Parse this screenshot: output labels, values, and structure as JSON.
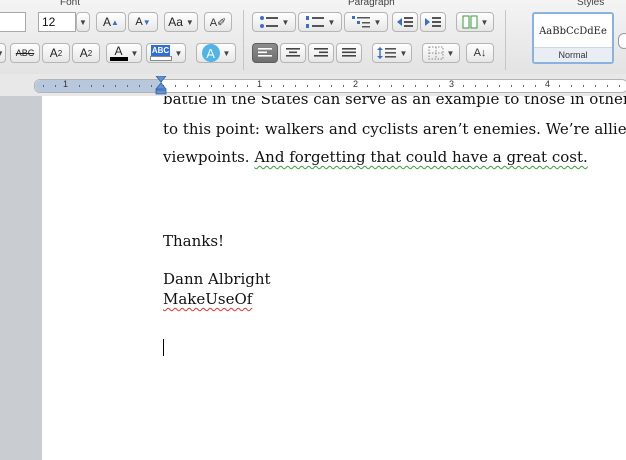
{
  "ribbon": {
    "groups": {
      "font": "Font",
      "paragraph": "Paragraph",
      "styles": "Styles"
    },
    "font_size": "12",
    "strikethrough_label": "ABC",
    "superscript_label": "A",
    "superscript_mark": "2",
    "subscript_label": "A",
    "subscript_mark": "2",
    "grow_font_label": "A",
    "shrink_font_label": "A",
    "change_case_label": "Aa",
    "font_color_label": "A",
    "highlight_label": "ABC",
    "text_effects_label": "A",
    "style_sample": "AaBbCcDdEe",
    "style_name": "Normal",
    "colors": {
      "font_color": "#000000",
      "highlight": "#2f6fd6",
      "text_effects": "#4fb4e8"
    }
  },
  "ruler": {
    "numbers": [
      "1",
      "1",
      "2",
      "3",
      "4"
    ]
  },
  "document": {
    "line_top": "battle in the States can serve as an example to those in other countri",
    "line1": "to this point: walkers and cyclists aren’t enemies. We’re allies with",
    "line2_plain": "viewpoints. ",
    "line2_underlined": "And forgetting that could have a great cost.",
    "thanks": "Thanks!",
    "signature_name": "Dann Albright",
    "signature_company": "MakeUseOf"
  }
}
